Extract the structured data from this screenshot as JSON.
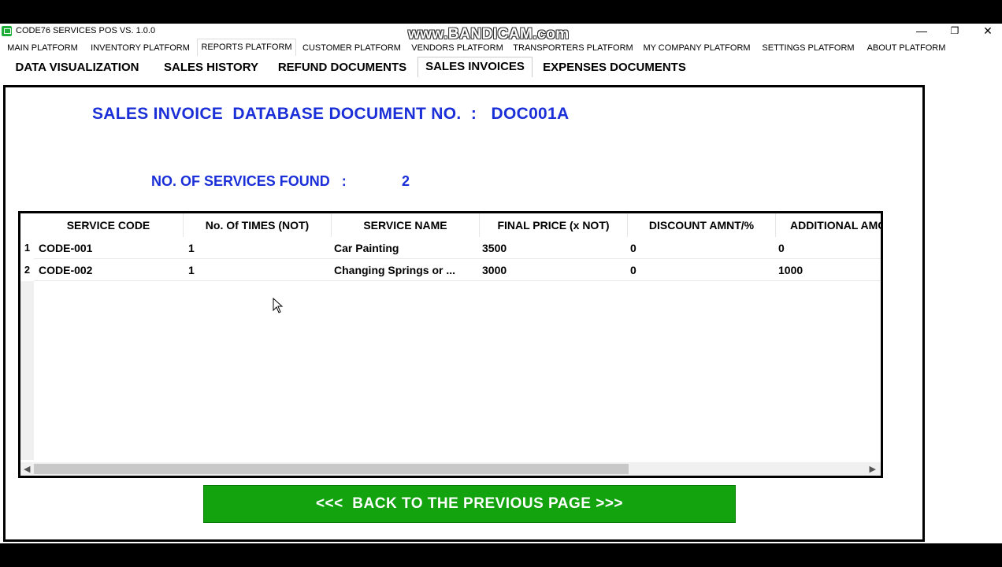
{
  "window": {
    "title": "CODE76 SERVICES POS VS. 1.0.0",
    "watermark": "www.BANDICAM.com",
    "controls": {
      "minimize": "—",
      "maximize": "❐",
      "close": "✕"
    }
  },
  "platform_tabs": [
    {
      "label": "MAIN PLATFORM",
      "active": false
    },
    {
      "label": "INVENTORY PLATFORM",
      "active": false
    },
    {
      "label": "REPORTS PLATFORM",
      "active": true
    },
    {
      "label": "CUSTOMER PLATFORM",
      "active": false
    },
    {
      "label": "VENDORS PLATFORM",
      "active": false
    },
    {
      "label": "TRANSPORTERS PLATFORM",
      "active": false
    },
    {
      "label": "MY COMPANY PLATFORM",
      "active": false
    },
    {
      "label": "SETTINGS PLATFORM",
      "active": false
    },
    {
      "label": "ABOUT PLATFORM",
      "active": false
    }
  ],
  "sub_tabs": [
    {
      "label": "DATA VISUALIZATION",
      "active": false
    },
    {
      "label": "SALES HISTORY",
      "active": false
    },
    {
      "label": "REFUND DOCUMENTS",
      "active": false
    },
    {
      "label": "SALES INVOICES",
      "active": true
    },
    {
      "label": "EXPENSES DOCUMENTS",
      "active": false
    }
  ],
  "document": {
    "title": "SALES INVOICE  DATABASE DOCUMENT NO.  :   DOC001A",
    "found_label": "NO. OF SERVICES FOUND   :",
    "found_value": "2"
  },
  "table": {
    "columns": [
      "SERVICE CODE",
      "No. Of TIMES (NOT)",
      "SERVICE NAME",
      "FINAL PRICE (x NOT)",
      "DISCOUNT AMNT/%",
      "ADDITIONAL AMOUNT"
    ],
    "rows": [
      {
        "num": "1",
        "cells": [
          "CODE-001",
          "1",
          "Car Painting",
          "3500",
          "0",
          "0"
        ]
      },
      {
        "num": "2",
        "cells": [
          "CODE-002",
          "1",
          "Changing Springs or ...",
          "3000",
          "0",
          "1000"
        ]
      }
    ],
    "scroll_left_icon": "◀",
    "scroll_right_icon": "▶"
  },
  "back_button": {
    "label": "<<<  BACK TO THE PREVIOUS PAGE >>>"
  },
  "colors": {
    "title_blue": "#1a2fd8",
    "button_green": "#13a30f"
  }
}
